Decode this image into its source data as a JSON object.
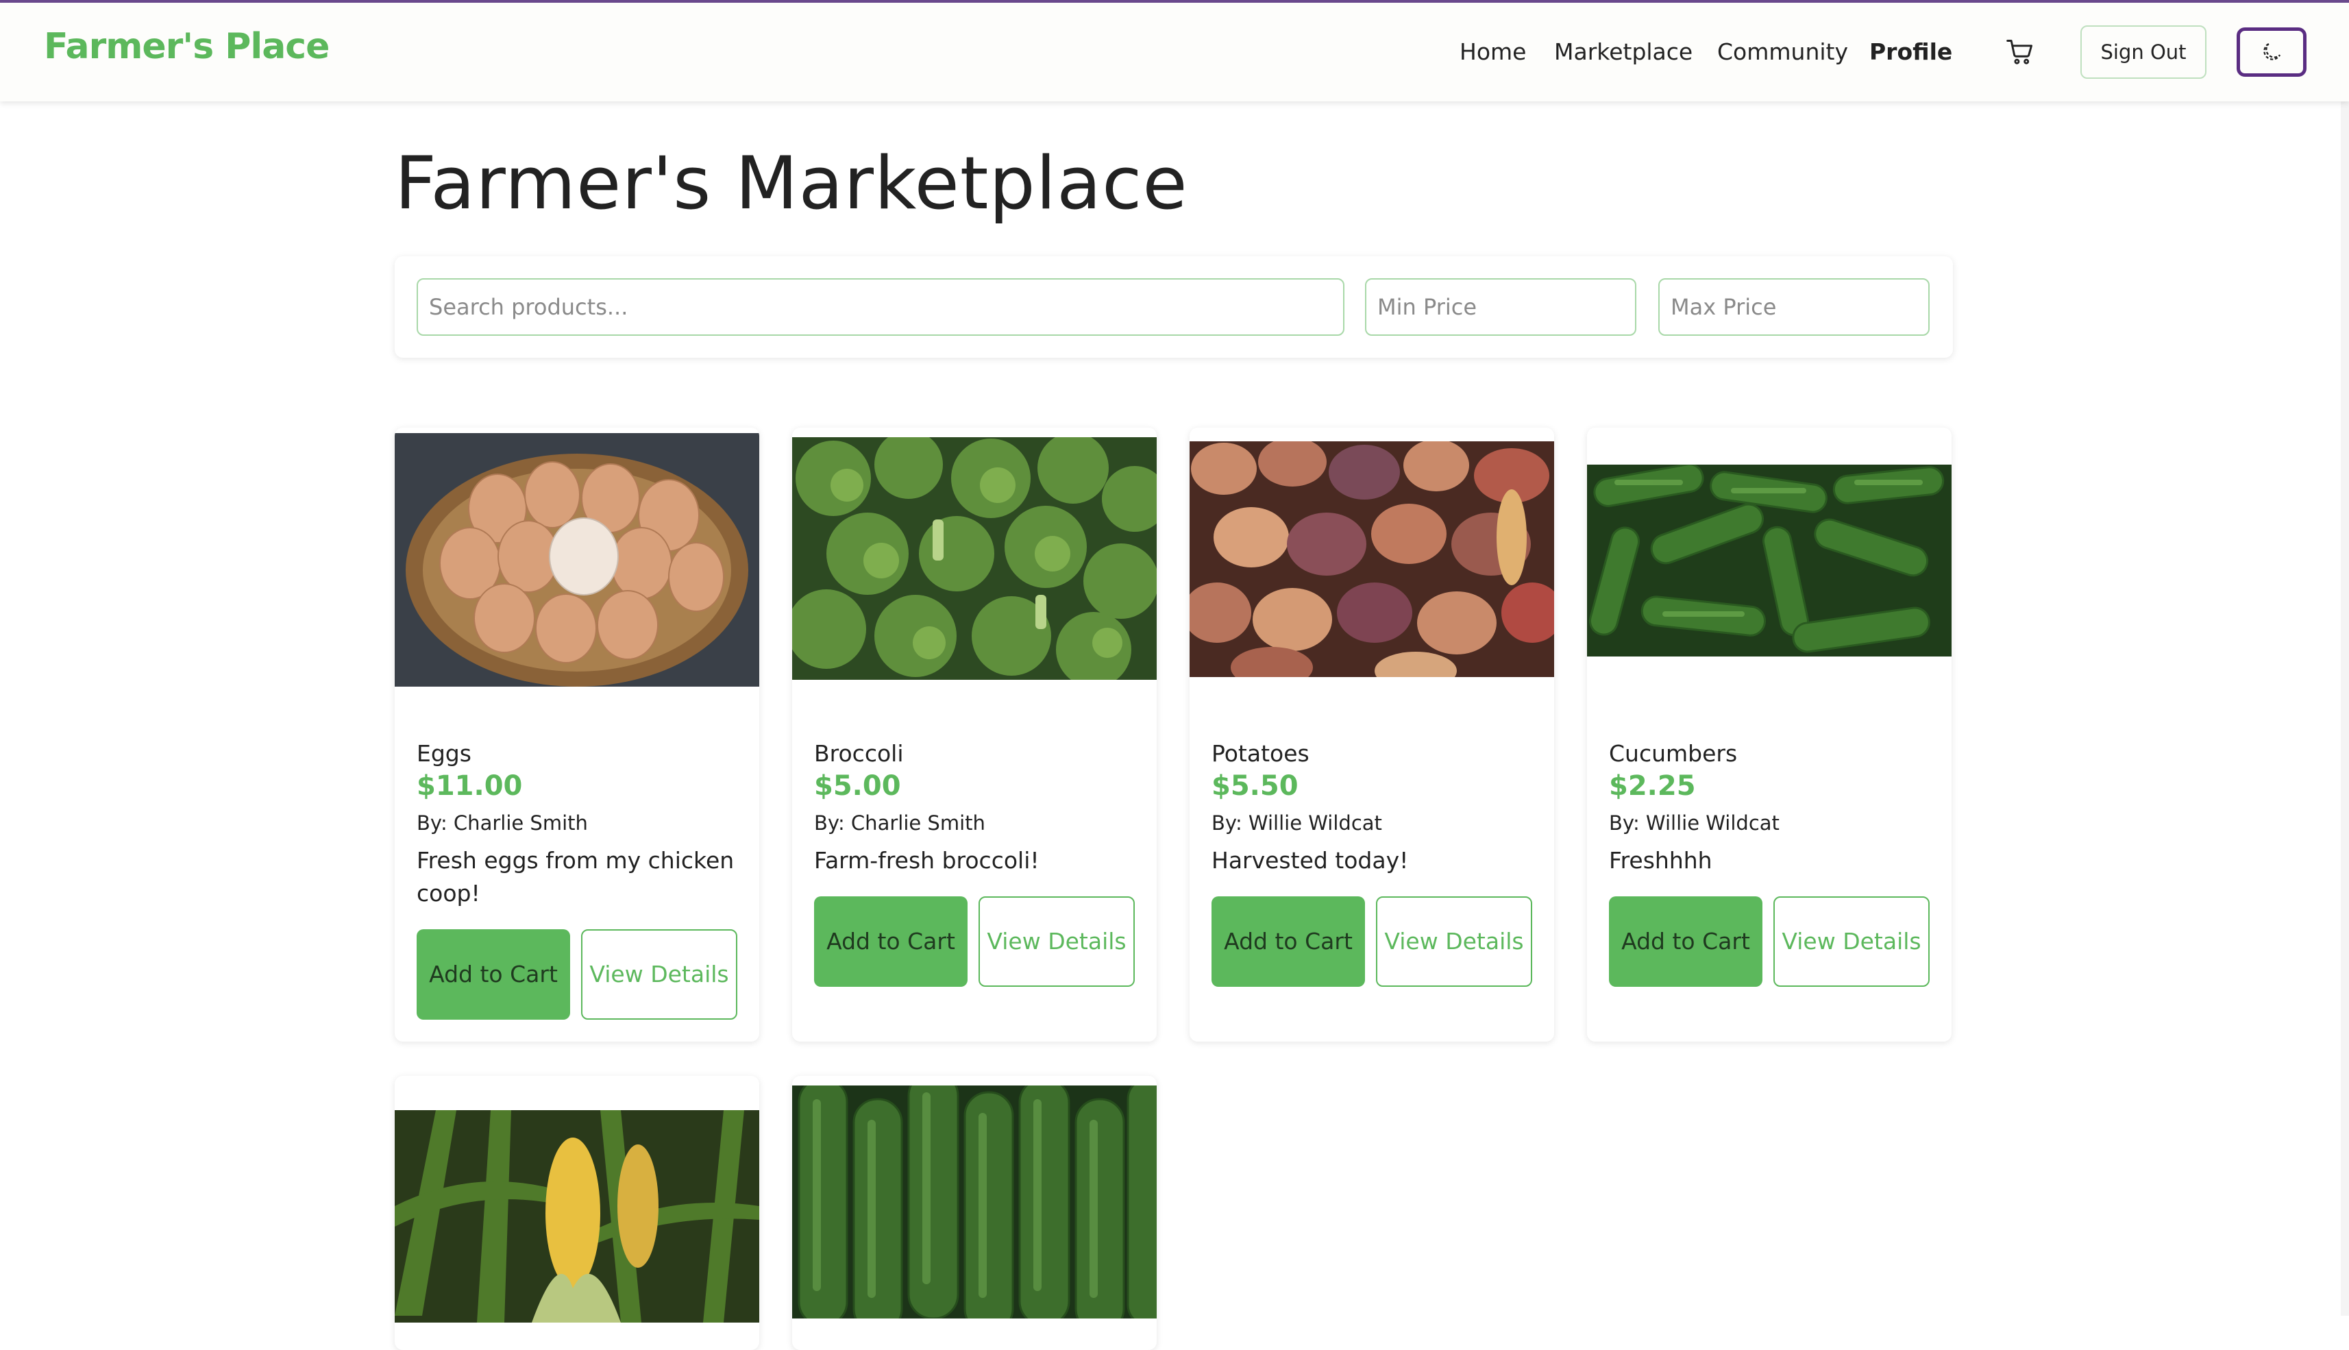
{
  "header": {
    "logo": "Farmer's Place",
    "nav": [
      {
        "label": "Home"
      },
      {
        "label": "Marketplace"
      },
      {
        "label": "Community"
      },
      {
        "label": "Profile"
      }
    ],
    "cart_icon": "shopping-cart-icon",
    "sign_out_label": "Sign Out",
    "theme_icon": "moon-icon"
  },
  "main": {
    "title": "Farmer's Marketplace",
    "filters": {
      "search_placeholder": "Search products...",
      "min_price_placeholder": "Min Price",
      "max_price_placeholder": "Max Price"
    },
    "products": [
      {
        "name": "Eggs",
        "price": "$11.00",
        "seller": "By: Charlie Smith",
        "description": "Fresh eggs from my chicken coop!",
        "add_label": "Add to Cart",
        "view_label": "View Details",
        "image": "eggs-in-basket"
      },
      {
        "name": "Broccoli",
        "price": "$5.00",
        "seller": "By: Charlie Smith",
        "description": "Farm-fresh broccoli!",
        "add_label": "Add to Cart",
        "view_label": "View Details",
        "image": "broccoli-pile"
      },
      {
        "name": "Potatoes",
        "price": "$5.50",
        "seller": "By: Willie Wildcat",
        "description": "Harvested today!",
        "add_label": "Add to Cart",
        "view_label": "View Details",
        "image": "potatoes-pile"
      },
      {
        "name": "Cucumbers",
        "price": "$2.25",
        "seller": "By: Willie Wildcat",
        "description": "Freshhhh",
        "add_label": "Add to Cart",
        "view_label": "View Details",
        "image": "cucumbers-pile"
      },
      {
        "image": "corn-stalks"
      },
      {
        "image": "cucumbers-closeup"
      }
    ]
  },
  "colors": {
    "brand_green": "#5cb85c",
    "accent_purple": "#5a2d82"
  }
}
